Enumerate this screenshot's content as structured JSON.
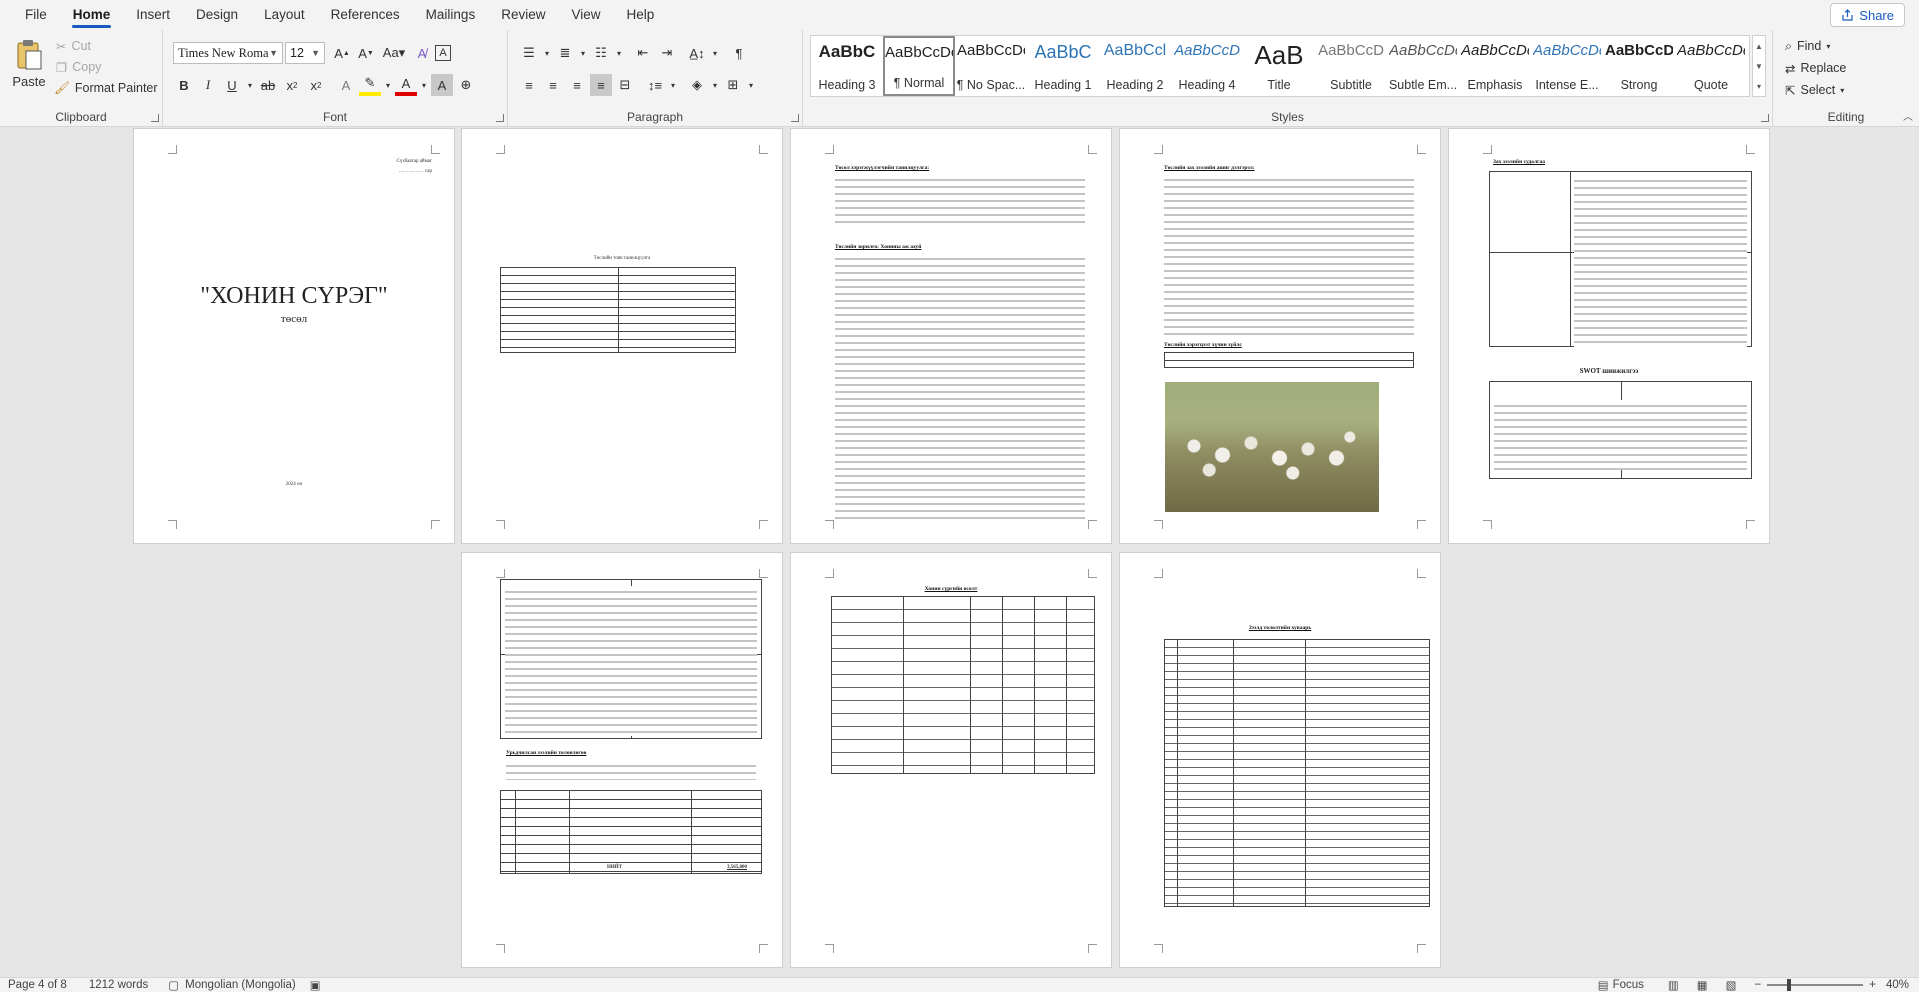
{
  "menu": {
    "tabs": [
      "File",
      "Home",
      "Insert",
      "Design",
      "Layout",
      "References",
      "Mailings",
      "Review",
      "View",
      "Help"
    ],
    "active_tab": "Home",
    "share_label": "Share"
  },
  "ribbon": {
    "clipboard": {
      "label": "Clipboard",
      "paste": "Paste",
      "cut": "Cut",
      "copy": "Copy",
      "format_painter": "Format Painter"
    },
    "font": {
      "label": "Font",
      "font_name": "Times New Roma",
      "font_size": "12"
    },
    "paragraph": {
      "label": "Paragraph"
    },
    "styles": {
      "label": "Styles",
      "items": [
        {
          "sample": "AaBbC",
          "name": "Heading 3"
        },
        {
          "sample": "AaBbCcDc",
          "name": "¶ Normal"
        },
        {
          "sample": "AaBbCcDc",
          "name": "¶ No Spac..."
        },
        {
          "sample": "AaBbC",
          "name": "Heading 1"
        },
        {
          "sample": "AaBbCcl",
          "name": "Heading 2"
        },
        {
          "sample": "AaBbCcD",
          "name": "Heading 4"
        },
        {
          "sample": "AaB",
          "name": "Title"
        },
        {
          "sample": "AaBbCcD",
          "name": "Subtitle"
        },
        {
          "sample": "AaBbCcDc",
          "name": "Subtle Em..."
        },
        {
          "sample": "AaBbCcDc",
          "name": "Emphasis"
        },
        {
          "sample": "AaBbCcDc",
          "name": "Intense E..."
        },
        {
          "sample": "AaBbCcDc",
          "name": "Strong"
        },
        {
          "sample": "AaBbCcDc",
          "name": "Quote"
        }
      ]
    },
    "editing": {
      "label": "Editing",
      "find": "Find",
      "replace": "Replace",
      "select": "Select"
    }
  },
  "document": {
    "cover_title": "\"ХОНИН СҮРЭГ\"",
    "cover_subtitle": "төсөл",
    "cover_year": "2024 он",
    "cover_top_right": "Сүхбаатар аймаг",
    "p2_caption": "Төслийн товч танилцуулга",
    "p3_h1": "Төсөл хэрэгжүүлэгчийн танилцуулга:",
    "p3_h2": "Төслийн зорилго: Хонины аж ахуй",
    "p4_h1": "Төслийн зах зээлийн ашиг дэлгэрэл:",
    "p4_h2": "Төслийн хэрэгцээт хүчин зүйлс",
    "p5_h1": "Зах зээлийн судалгаа",
    "p5_swot": "SWOT шинжилгээ",
    "p7_h1": "Хонин сүргийн өсөлт",
    "p8_h1": "Зээлд төлөлтийн хуваарь",
    "p6_h1": "Урьдчилсан зээлийн төлөвлөгөө",
    "p6_total_label": "НИЙТ",
    "p6_total_value": "3,565,000"
  },
  "status": {
    "page": "Page 4 of 8",
    "words": "1212 words",
    "language": "Mongolian (Mongolia)",
    "focus": "Focus",
    "zoom": "40%"
  }
}
